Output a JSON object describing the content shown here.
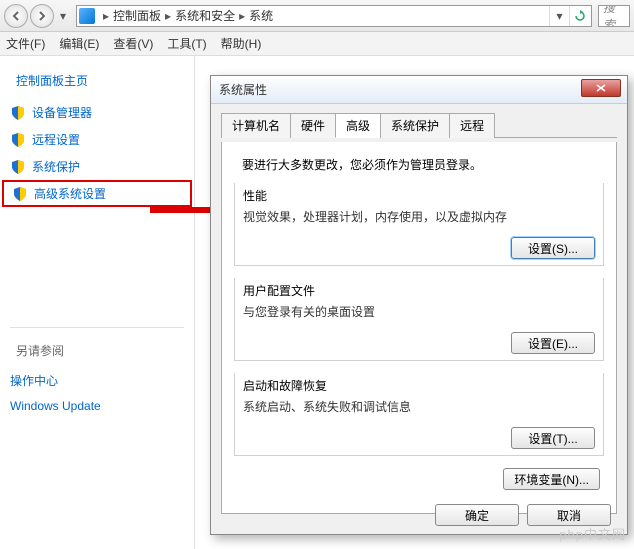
{
  "breadcrumb": {
    "root_icon": true,
    "items": [
      "控制面板",
      "系统和安全",
      "系统"
    ]
  },
  "search": {
    "placeholder": "搜索"
  },
  "menubar": [
    {
      "label": "文件(F)"
    },
    {
      "label": "编辑(E)"
    },
    {
      "label": "查看(V)"
    },
    {
      "label": "工具(T)"
    },
    {
      "label": "帮助(H)"
    }
  ],
  "sidebar": {
    "heading": "控制面板主页",
    "links": [
      {
        "label": "设备管理器"
      },
      {
        "label": "远程设置"
      },
      {
        "label": "系统保护"
      },
      {
        "label": "高级系统设置",
        "selected": true
      }
    ],
    "see_also_heading": "另请参阅",
    "see_also": [
      {
        "label": "操作中心"
      },
      {
        "label": "Windows Update"
      }
    ]
  },
  "dialog": {
    "title": "系统属性",
    "tabs": [
      {
        "label": "计算机名"
      },
      {
        "label": "硬件"
      },
      {
        "label": "高级",
        "active": true
      },
      {
        "label": "系统保护"
      },
      {
        "label": "远程"
      }
    ],
    "admin_note": "要进行大多数更改，您必须作为管理员登录。",
    "groups": {
      "perf": {
        "title": "性能",
        "desc": "视觉效果，处理器计划，内存使用，以及虚拟内存",
        "button": "设置(S)..."
      },
      "profile": {
        "title": "用户配置文件",
        "desc": "与您登录有关的桌面设置",
        "button": "设置(E)..."
      },
      "startup": {
        "title": "启动和故障恢复",
        "desc": "系统启动、系统失败和调试信息",
        "button": "设置(T)..."
      }
    },
    "env_button": "环境变量(N)...",
    "ok": "确定",
    "cancel": "取消"
  },
  "watermark": "php中文网"
}
